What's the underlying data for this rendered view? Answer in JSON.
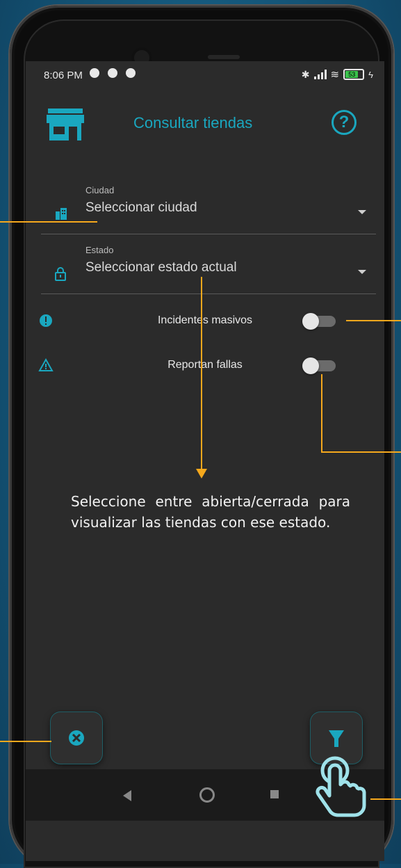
{
  "status_bar": {
    "time": "8:06 PM",
    "battery": "53"
  },
  "header": {
    "title": "Consultar tiendas",
    "help_icon": "help-icon",
    "store_icon": "store-icon"
  },
  "form": {
    "city": {
      "label": "Ciudad",
      "value": "Seleccionar ciudad",
      "icon": "city-icon"
    },
    "state": {
      "label": "Estado",
      "value": "Seleccionar estado actual",
      "icon": "lock-icon"
    }
  },
  "toggles": [
    {
      "label": "Incidentes masivos",
      "icon": "alert-circle-icon",
      "on": false
    },
    {
      "label": "Reportan fallas",
      "icon": "warning-triangle-icon",
      "on": false
    }
  ],
  "tip": "Seleccione entre abierta/cerrada para visualizar las tiendas con ese estado.",
  "colors": {
    "accent": "#1aa7bf",
    "annotation": "#f5a81c",
    "screen_bg": "#2b2b2b"
  }
}
